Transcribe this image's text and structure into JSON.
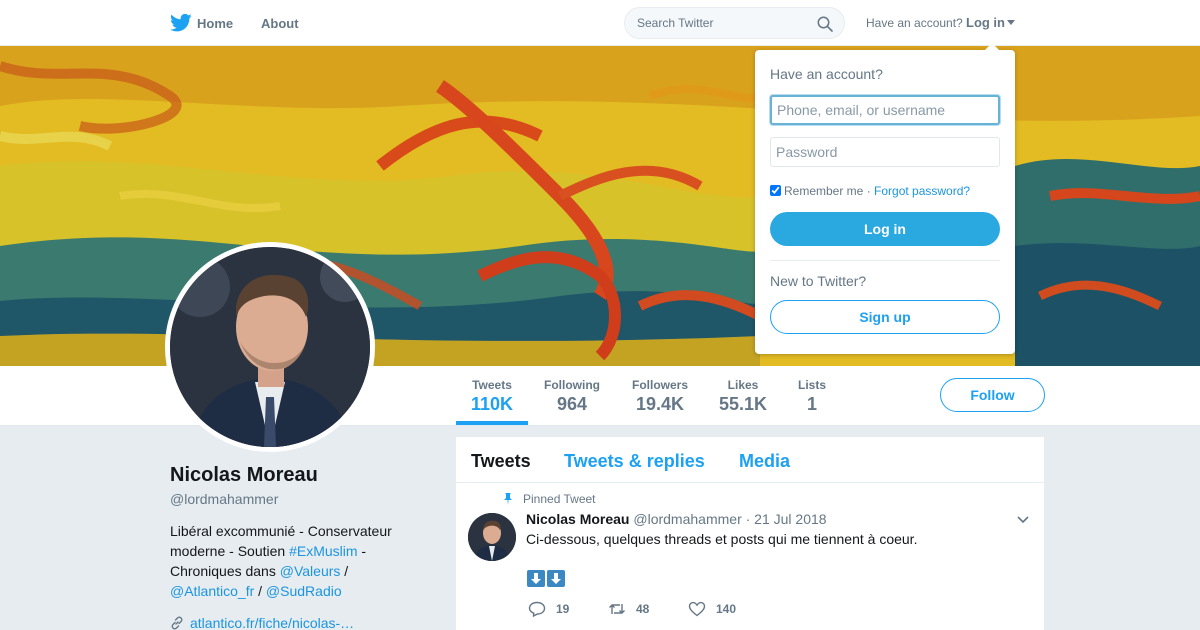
{
  "nav": {
    "home_label": "Home",
    "about_label": "About",
    "search_placeholder": "Search Twitter",
    "have_account_text": "Have an account?",
    "login_label": "Log in"
  },
  "profile": {
    "name": "Nicolas Moreau",
    "handle": "@lordmahammer",
    "bio": {
      "part1": "Libéral excommunié - Conservateur moderne - Soutien ",
      "hashtag": "#ExMuslim",
      "part2": " - Chroniques dans ",
      "mention1": "@Valeurs",
      "sep1": " / ",
      "mention2": "@Atlantico_fr",
      "sep2": " / ",
      "mention3": "@SudRadio"
    },
    "link": "atlantico.fr/fiche/nicolas-…"
  },
  "stats": [
    {
      "label": "Tweets",
      "value": "110K"
    },
    {
      "label": "Following",
      "value": "964"
    },
    {
      "label": "Followers",
      "value": "19.4K"
    },
    {
      "label": "Likes",
      "value": "55.1K"
    },
    {
      "label": "Lists",
      "value": "1"
    }
  ],
  "follow_label": "Follow",
  "timeline": {
    "tabs": [
      "Tweets",
      "Tweets & replies",
      "Media"
    ],
    "pinned_label": "Pinned Tweet",
    "tweet": {
      "name": "Nicolas Moreau",
      "handle": "@lordmahammer",
      "date": "· 21 Jul 2018",
      "text": "Ci-dessous, quelques threads et posts qui me tiennent à coeur.",
      "reply_count": "19",
      "retweet_count": "48",
      "like_count": "140"
    }
  },
  "login_dropdown": {
    "title": "Have an account?",
    "username_placeholder": "Phone, email, or username",
    "password_placeholder": "Password",
    "remember_label": "Remember me",
    "separator": " · ",
    "forgot_label": "Forgot password?",
    "login_button": "Log in",
    "new_text": "New to Twitter?",
    "signup_button": "Sign up"
  },
  "colors": {
    "accent": "#1da1f2",
    "login_button": "#2aa9e0",
    "text_muted": "#657786",
    "background": "#e6ecf0"
  }
}
